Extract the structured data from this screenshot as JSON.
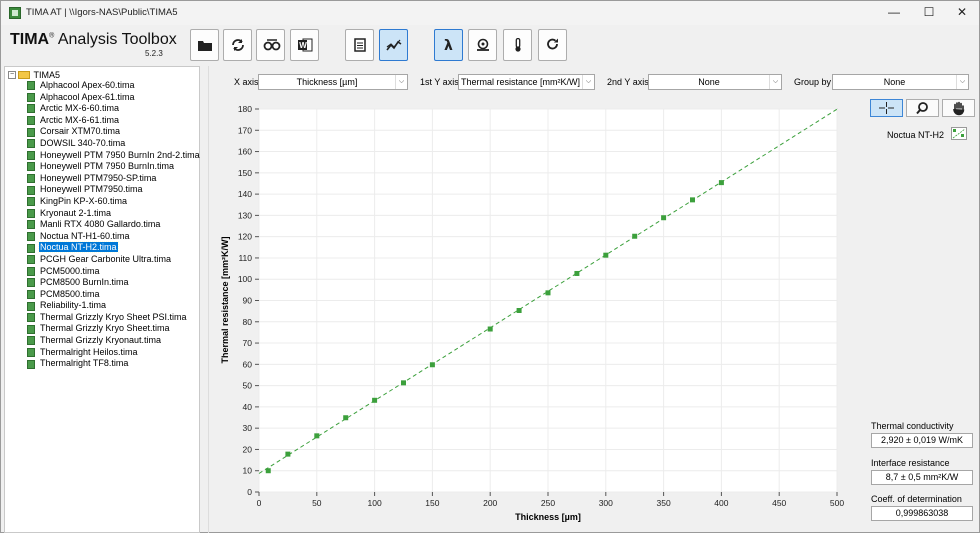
{
  "window": {
    "title": "TIMA AT | \\\\Igors-NAS\\Public\\TIMA5",
    "controls": {
      "minimize": "—",
      "maximize": "☐",
      "close": "✕"
    }
  },
  "branding": {
    "name_bold": "TIMA",
    "reg": "®",
    "name_rest": " Analysis Toolbox",
    "version": "5.2.3"
  },
  "toolbar": [
    {
      "name": "open-folder",
      "icon": "folder-icon",
      "active": false
    },
    {
      "name": "refresh",
      "icon": "refresh-icon",
      "active": false
    },
    {
      "name": "link",
      "icon": "link-icon",
      "active": false
    },
    {
      "name": "export-word",
      "icon": "word-icon",
      "active": false
    },
    {
      "name": "report",
      "icon": "document-icon",
      "active": false
    },
    {
      "name": "chart-view",
      "icon": "chart-line-icon",
      "active": true
    },
    {
      "name": "lambda",
      "icon": "lambda-icon",
      "active": true
    },
    {
      "name": "pressure",
      "icon": "gauge-icon",
      "active": false
    },
    {
      "name": "temperature",
      "icon": "thermometer-icon",
      "active": false
    },
    {
      "name": "rerun",
      "icon": "redo-icon",
      "active": false
    }
  ],
  "tree": {
    "root": "TIMA5",
    "expander": "−",
    "items": [
      "Alphacool Apex-60.tima",
      "Alphacool Apex-61.tima",
      "Arctic MX-6-60.tima",
      "Arctic MX-6-61.tima",
      "Corsair XTM70.tima",
      "DOWSIL 340-70.tima",
      "Honeywell PTM 7950 BurnIn 2nd-2.tima",
      "Honeywell PTM 7950 BurnIn.tima",
      "Honeywell PTM7950-SP.tima",
      "Honeywell PTM7950.tima",
      "KingPin KP-X-60.tima",
      "Kryonaut 2-1.tima",
      "Manli RTX 4080 Gallardo.tima",
      "Noctua NT-H1-60.tima",
      "Noctua NT-H2.tima",
      "PCGH Gear Carbonite Ultra.tima",
      "PCM5000.tima",
      "PCM8500 BurnIn.tima",
      "PCM8500.tima",
      "Reliability-1.tima",
      "Thermal Grizzly Kryo Sheet PSI.tima",
      "Thermal Grizzly Kryo Sheet.tima",
      "Thermal Grizzly Kryonaut.tima",
      "Thermalright Heilos.tima",
      "Thermalright TF8.tima"
    ],
    "selected_index": 14
  },
  "controls": {
    "x_axis": {
      "label": "X axis",
      "value": "Thickness [µm]"
    },
    "y1_axis": {
      "label": "1st Y axis",
      "value": "Thermal resistance [mm²K/W]"
    },
    "y2_axis": {
      "label": "2nd Y axis",
      "value": "None"
    },
    "group_by": {
      "label": "Group by",
      "value": "None"
    },
    "dropdown_arrow": "⌵"
  },
  "tools": [
    {
      "name": "crosshair",
      "icon": "crosshair-icon",
      "active": true
    },
    {
      "name": "zoom",
      "icon": "magnifier-icon",
      "active": false
    },
    {
      "name": "pan",
      "icon": "hand-icon",
      "active": false
    }
  ],
  "legend": {
    "label": "Noctua NT-H2",
    "color": "#3ca03c"
  },
  "stats": {
    "conductivity_label": "Thermal conductivity",
    "conductivity_value": "2,920 ± 0,019 W/mK",
    "resistance_label": "Interface resistance",
    "resistance_value": "8,7 ± 0,5 mm²K/W",
    "r2_label": "Coeff. of determination",
    "r2_value": "0,999863038"
  },
  "chart_data": {
    "type": "scatter",
    "xlabel": "Thickness [µm]",
    "ylabel": "Thermal resistance [mm²K/W]",
    "xlim": [
      0,
      500
    ],
    "ylim": [
      0,
      180
    ],
    "xticks": [
      0,
      50,
      100,
      150,
      200,
      250,
      300,
      350,
      400,
      450,
      500
    ],
    "yticks": [
      0,
      10,
      20,
      30,
      40,
      50,
      60,
      70,
      80,
      90,
      100,
      110,
      120,
      130,
      140,
      150,
      160,
      170,
      180
    ],
    "grid": true,
    "series": [
      {
        "name": "Noctua NT-H2",
        "color": "#3ca03c",
        "x": [
          8,
          25,
          50,
          75,
          100,
          125,
          150,
          200,
          225,
          250,
          275,
          300,
          325,
          350,
          375,
          400
        ],
        "y": [
          10,
          17.8,
          26.4,
          34.9,
          43.1,
          51.3,
          59.8,
          76.6,
          85.3,
          93.6,
          102.7,
          111.3,
          120.2,
          128.9,
          137.3,
          145.4
        ]
      }
    ],
    "fit_line": {
      "style": "dashed",
      "color": "#3ca03c",
      "x": [
        0,
        500
      ],
      "y": [
        8.7,
        179.9
      ]
    }
  }
}
